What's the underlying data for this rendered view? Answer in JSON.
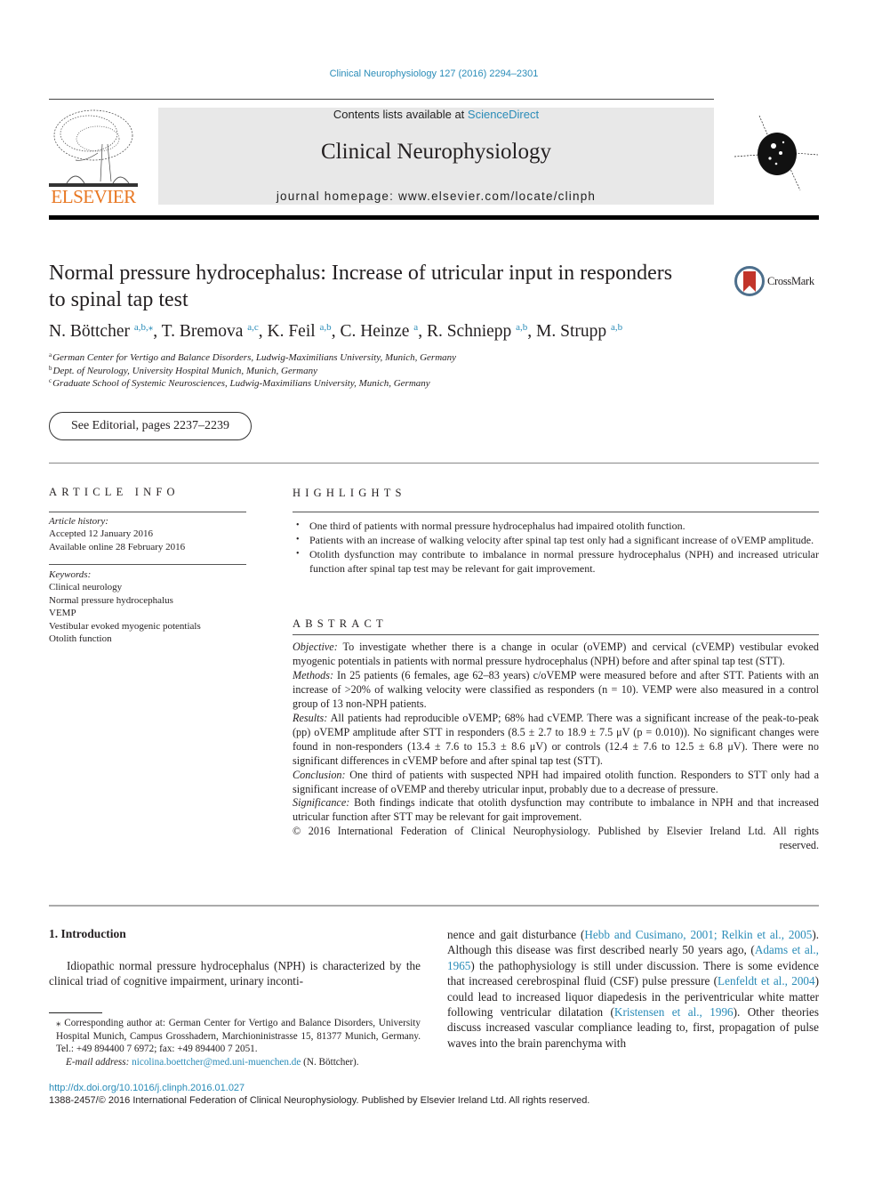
{
  "header": {
    "journal_ref": "Clinical Neurophysiology 127 (2016) 2294–2301",
    "contents_prefix": "Contents lists available at ",
    "contents_link": "ScienceDirect",
    "journal_title": "Clinical Neurophysiology",
    "homepage": "journal homepage: www.elsevier.com/locate/clinph",
    "publisher": "ELSEVIER",
    "brand_color": "#e87722",
    "link_color": "#2a8cb8"
  },
  "article": {
    "title": "Normal pressure hydrocephalus: Increase of utricular input in responders to spinal tap test",
    "crossmark": "CrossMark",
    "authors": [
      {
        "name": "N. Böttcher",
        "sup": "a,b,⁎"
      },
      {
        "name": "T. Bremova",
        "sup": "a,c"
      },
      {
        "name": "K. Feil",
        "sup": "a,b"
      },
      {
        "name": "C. Heinze",
        "sup": "a"
      },
      {
        "name": "R. Schniepp",
        "sup": "a,b"
      },
      {
        "name": "M. Strupp",
        "sup": "a,b"
      }
    ],
    "affiliations": [
      {
        "key": "a",
        "text": "German Center for Vertigo and Balance Disorders, Ludwig-Maximilians University, Munich, Germany"
      },
      {
        "key": "b",
        "text": "Dept. of Neurology, University Hospital Munich, Munich, Germany"
      },
      {
        "key": "c",
        "text": "Graduate School of Systemic Neurosciences, Ludwig-Maximilians University, Munich, Germany"
      }
    ],
    "editorial": "See Editorial, pages 2237–2239"
  },
  "article_info": {
    "heading": "ARTICLE INFO",
    "history_label": "Article history:",
    "history": [
      "Accepted 12 January 2016",
      "Available online 28 February 2016"
    ],
    "keywords_label": "Keywords:",
    "keywords": [
      "Clinical neurology",
      "Normal pressure hydrocephalus",
      "VEMP",
      "Vestibular evoked myogenic potentials",
      "Otolith function"
    ]
  },
  "highlights": {
    "heading": "HIGHLIGHTS",
    "items": [
      "One third of patients with normal pressure hydrocephalus had impaired otolith function.",
      "Patients with an increase of walking velocity after spinal tap test only had a significant increase of oVEMP amplitude.",
      "Otolith dysfunction may contribute to imbalance in normal pressure hydrocephalus (NPH) and increased utricular function after spinal tap test may be relevant for gait improvement."
    ]
  },
  "abstract": {
    "heading": "ABSTRACT",
    "sections": [
      {
        "label": "Objective:",
        "text": " To investigate whether there is a change in ocular (oVEMP) and cervical (cVEMP) vestibular evoked myogenic potentials in patients with normal pressure hydrocephalus (NPH) before and after spinal tap test (STT)."
      },
      {
        "label": "Methods:",
        "text": " In 25 patients (6 females, age 62–83 years) c/oVEMP were measured before and after STT. Patients with an increase of >20% of walking velocity were classified as responders (n = 10). VEMP were also measured in a control group of 13 non-NPH patients."
      },
      {
        "label": "Results:",
        "text": " All patients had reproducible oVEMP; 68% had cVEMP. There was a significant increase of the peak-to-peak (pp) oVEMP amplitude after STT in responders (8.5 ± 2.7 to 18.9 ± 7.5 μV (p = 0.010)). No significant changes were found in non-responders (13.4 ± 7.6 to 15.3 ± 8.6 μV) or controls (12.4 ± 7.6 to 12.5 ± 6.8 μV). There were no significant differences in cVEMP before and after spinal tap test (STT)."
      },
      {
        "label": "Conclusion:",
        "text": " One third of patients with suspected NPH had impaired otolith function. Responders to STT only had a significant increase of oVEMP and thereby utricular input, probably due to a decrease of pressure."
      },
      {
        "label": "Significance:",
        "text": "  Both findings indicate that otolith dysfunction may contribute to imbalance in NPH and that increased utricular function after STT may be relevant for gait improvement."
      }
    ],
    "copyright": "© 2016 International Federation of Clinical Neurophysiology. Published by Elsevier Ireland Ltd. All rights",
    "copyright_end": "reserved."
  },
  "introduction": {
    "heading": "1. Introduction",
    "left_text": "Idiopathic normal pressure hydrocephalus (NPH) is characterized by the clinical triad of cognitive impairment, urinary inconti-",
    "right_parts": [
      {
        "t": "nence and gait disturbance (",
        "link": false
      },
      {
        "t": "Hebb and Cusimano, 2001; Relkin et al., 2005",
        "link": true
      },
      {
        "t": "). Although this disease was first described nearly 50 years ago, (",
        "link": false
      },
      {
        "t": "Adams et al., 1965",
        "link": true
      },
      {
        "t": ") the pathophysiology is still under discussion. There is some evidence that increased cerebrospinal fluid (CSF) pulse pressure (",
        "link": false
      },
      {
        "t": "Lenfeldt et al., 2004",
        "link": true
      },
      {
        "t": ") could lead to increased liquor diapedesis in the periventricular white matter following ventricular dilatation (",
        "link": false
      },
      {
        "t": "Kristensen et al., 1996",
        "link": true
      },
      {
        "t": "). Other theories discuss increased vascular compliance leading to, first, propagation of pulse waves into the brain parenchyma with",
        "link": false
      }
    ]
  },
  "footnote": {
    "corresponding": "⁎ Corresponding author at: German Center for Vertigo and Balance Disorders, University Hospital Munich, Campus Grosshadern, Marchioninistrasse 15, 81377 Munich, Germany. Tel.: +49 894400 7 6972; fax: +49 894400 7 2051.",
    "email_label": "E-mail address: ",
    "email": "nicolina.boettcher@med.uni-muenchen.de",
    "email_suffix": " (N. Böttcher)."
  },
  "footer": {
    "doi": "http://dx.doi.org/10.1016/j.clinph.2016.01.027",
    "issn": "1388-2457/© 2016 International Federation of Clinical Neurophysiology. Published by Elsevier Ireland Ltd. All rights reserved."
  }
}
